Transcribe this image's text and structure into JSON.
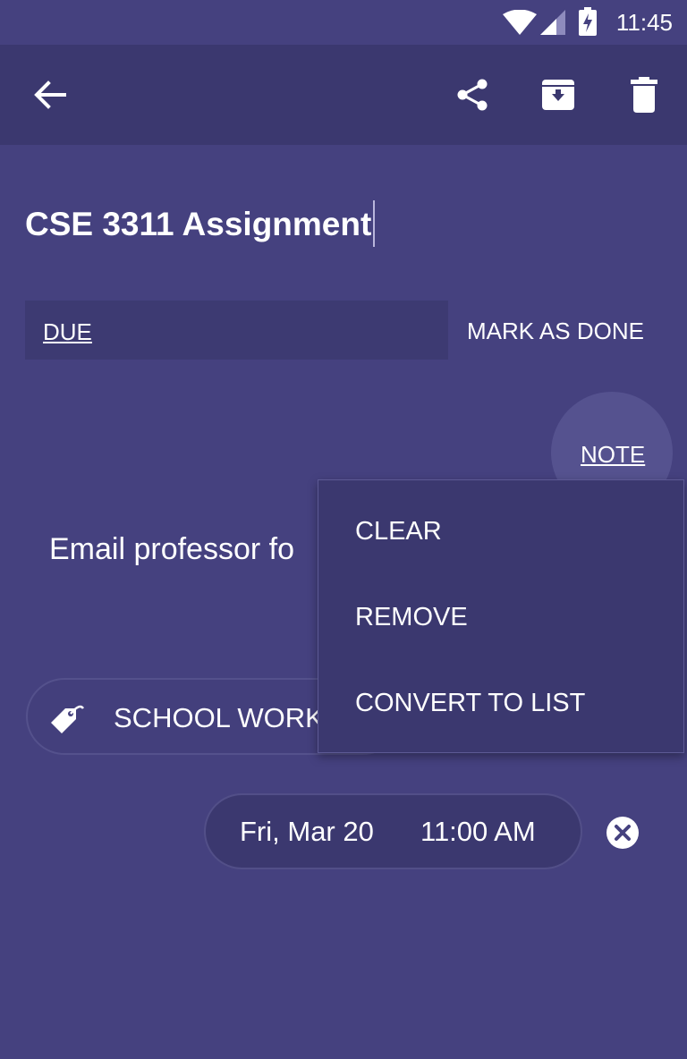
{
  "status_bar": {
    "time": "11:45",
    "icons": [
      "wifi-icon",
      "cell-signal-icon",
      "battery-charging-icon"
    ]
  },
  "app_bar": {
    "icons": [
      "back-arrow-icon",
      "share-icon",
      "archive-icon",
      "trash-icon"
    ]
  },
  "note": {
    "title": "CSE 3311 Assignment",
    "due_label": "DUE",
    "mark_done_label": "MARK AS DONE",
    "note_label": "NOTE",
    "body_preview": "Email professor fo",
    "tag": "SCHOOL WORK",
    "tag_icon": "tag-icon",
    "reminder": {
      "date": "Fri, Mar 20",
      "time": "11:00 AM",
      "clear_icon": "clear-circle-icon"
    }
  },
  "menu": {
    "items": [
      {
        "label": "CLEAR"
      },
      {
        "label": "REMOVE"
      },
      {
        "label": "CONVERT TO LIST"
      }
    ]
  },
  "colors": {
    "background": "#45417f",
    "app_bar": "#3b386f",
    "surface": "#3d3a72",
    "text": "#ffffff"
  }
}
